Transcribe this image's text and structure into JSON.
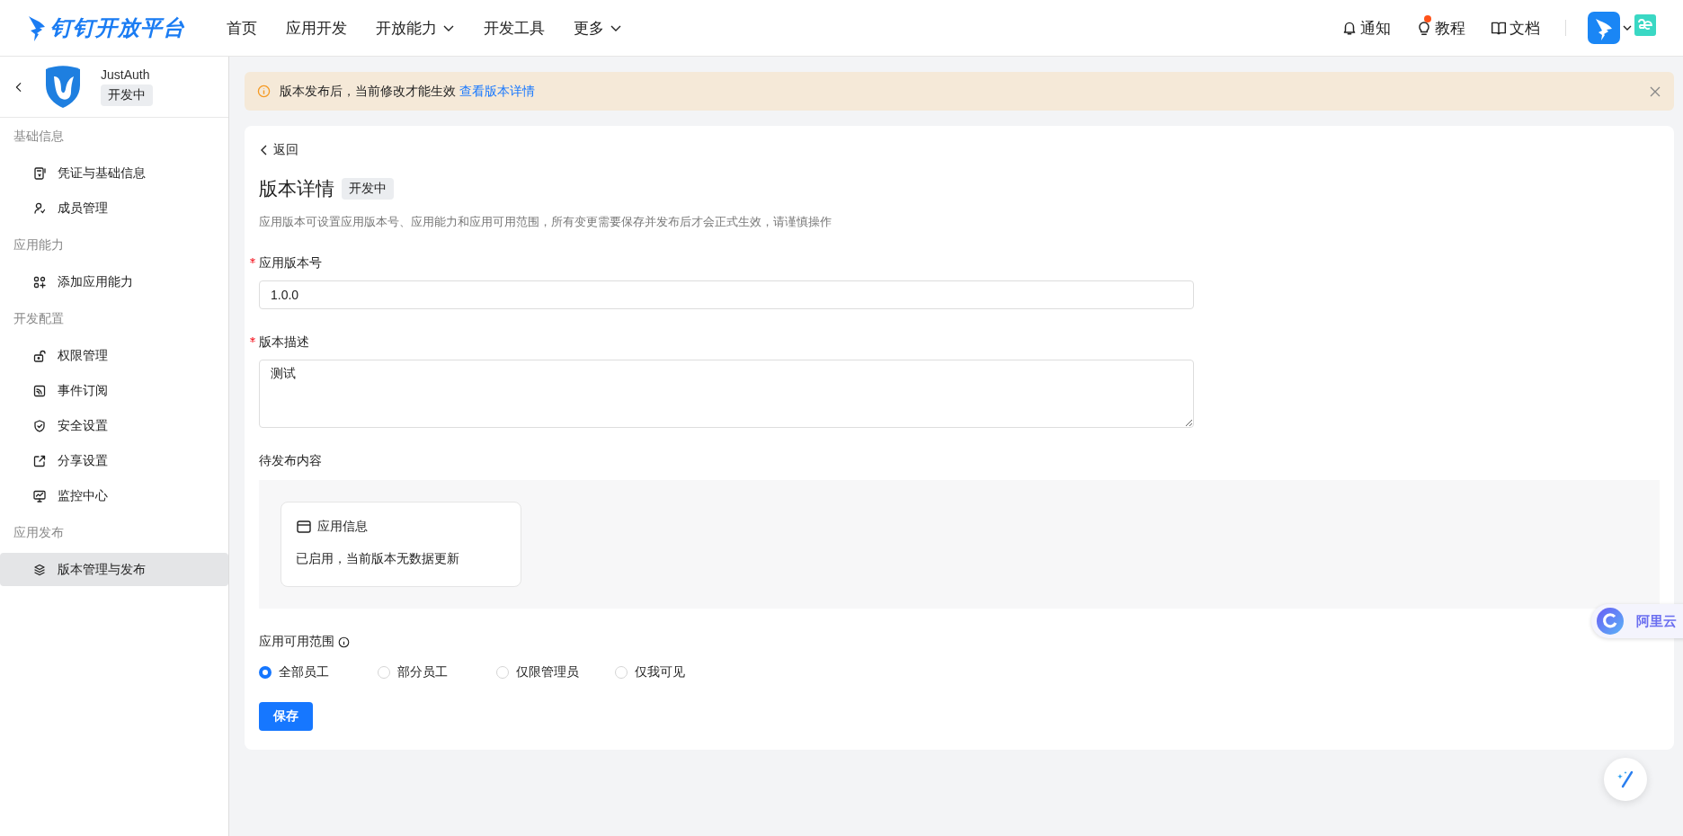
{
  "header": {
    "logo_text": "钉钉开放平台",
    "nav": [
      {
        "label": "首页",
        "has_menu": false
      },
      {
        "label": "应用开发",
        "has_menu": false
      },
      {
        "label": "开放能力",
        "has_menu": true
      },
      {
        "label": "开发工具",
        "has_menu": false
      },
      {
        "label": "更多",
        "has_menu": true
      }
    ],
    "links": [
      {
        "label": "通知",
        "dot": false
      },
      {
        "label": "教程",
        "dot": true
      },
      {
        "label": "文档",
        "dot": false
      }
    ]
  },
  "sidebar": {
    "app_name": "JustAuth",
    "app_status": "开发中",
    "groups": [
      {
        "title": "基础信息",
        "items": [
          {
            "label": "凭证与基础信息",
            "selected": false
          },
          {
            "label": "成员管理",
            "selected": false
          }
        ]
      },
      {
        "title": "应用能力",
        "items": [
          {
            "label": "添加应用能力",
            "selected": false
          }
        ]
      },
      {
        "title": "开发配置",
        "items": [
          {
            "label": "权限管理",
            "selected": false
          },
          {
            "label": "事件订阅",
            "selected": false
          },
          {
            "label": "安全设置",
            "selected": false
          },
          {
            "label": "分享设置",
            "selected": false
          },
          {
            "label": "监控中心",
            "selected": false
          }
        ]
      },
      {
        "title": "应用发布",
        "items": [
          {
            "label": "版本管理与发布",
            "selected": true
          }
        ]
      }
    ]
  },
  "alert": {
    "message": "版本发布后，当前修改才能生效",
    "link": "查看版本详情"
  },
  "page": {
    "back": "返回",
    "title": "版本详情",
    "status": "开发中",
    "description": "应用版本可设置应用版本号、应用能力和应用可用范围，所有变更需要保存并发布后才会正式生效，请谨慎操作",
    "fields": [
      {
        "label": "应用版本号",
        "required": true,
        "kind": "input",
        "value": "1.0.0"
      },
      {
        "label": "版本描述",
        "required": true,
        "kind": "textarea",
        "value": "测试"
      }
    ],
    "pending": {
      "title": "待发布内容",
      "cards": [
        {
          "title": "应用信息",
          "text": "已启用，当前版本无数据更新"
        }
      ]
    },
    "scope": {
      "label": "应用可用范围",
      "options": [
        {
          "label": "全部员工",
          "selected": true
        },
        {
          "label": "部分员工",
          "selected": false
        },
        {
          "label": "仅限管理员",
          "selected": false
        },
        {
          "label": "仅我可见",
          "selected": false
        }
      ]
    },
    "save": "保存"
  },
  "floating": {
    "drive_label": "阿里云"
  }
}
